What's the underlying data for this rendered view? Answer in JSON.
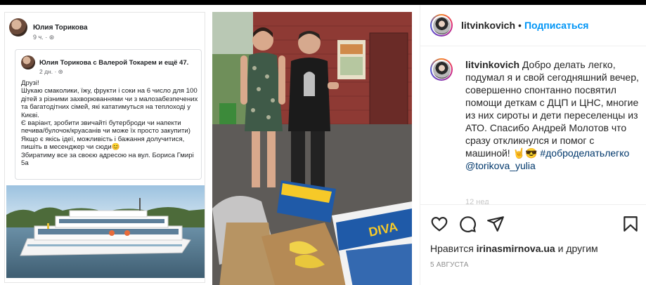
{
  "header": {
    "username": "litvinkovich",
    "separator": "•",
    "follow_label": "Подписаться"
  },
  "caption": {
    "username": "litvinkovich",
    "text_main": "Добро делать легко, подумал я и свой сегодняшний вечер, совершенно спонтанно посвятил помощи деткам с ДЦП и ЦНС, многие из них сироты и дети переселенцы из АТО.",
    "text_thanks": "Спасибо Андрей Молотов что сразу откликнулся и помог с машиной! 🤘😎",
    "hashtag": "#доброделатьлегко",
    "mention": "@torikova_yulia",
    "time_fade": "12 нед"
  },
  "likes": {
    "prefix": "Нравится",
    "user": "irinasmirnova.ua",
    "suffix": "и другим"
  },
  "date": "5 АВГУСТА",
  "post_image": {
    "fb": {
      "author": "Юлия Торикова",
      "time": "9 ч. · ⊛",
      "shared_author": "Юлия Торикова с Валерой Токарем и ещё 47.",
      "shared_time": "2 дн. · ⊛",
      "text": "Друзі!\nШукаю смаколики, їжу, фрукти і соки на 6 число для 100 дітей з різними захворюваннями чи з малозабезпечених та багатодітних сімей, які кататимуться на теплоході у Києві.\nЄ варіант, зробити звичайті бутерброди чи напекти печива/булочок/круасанів чи може їх просто закупити)\nЯкщо є якісь ідеї, можливість і бажання долучитися, пишіть в месенджер чи сюди😊\nЗбиратиму все за своєю адресою на вул. Бориса Гмирі 5а"
    },
    "box_label": "DIVA"
  },
  "icons": [
    "heart-icon",
    "comment-icon",
    "share-icon",
    "bookmark-icon"
  ]
}
